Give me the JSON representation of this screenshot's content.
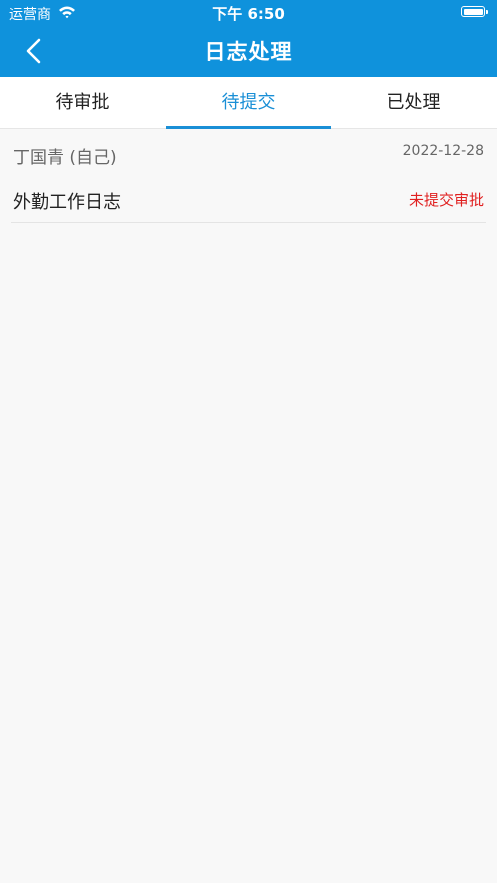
{
  "status_bar": {
    "carrier": "运营商",
    "time": "下午 6:50"
  },
  "nav": {
    "title": "日志处理",
    "back_icon": "chevron-left-icon"
  },
  "tabs": [
    {
      "label": "待审批",
      "active": false
    },
    {
      "label": "待提交",
      "active": true
    },
    {
      "label": "已处理",
      "active": false
    }
  ],
  "items": [
    {
      "author": "丁国青 (自己)",
      "date": "2022-12-28",
      "title": "外勤工作日志",
      "status": "未提交审批"
    }
  ],
  "colors": {
    "header_bg": "#0f92dc",
    "accent": "#1a8fd6",
    "status_red": "#e02020",
    "page_bg": "#f8f8f8"
  }
}
